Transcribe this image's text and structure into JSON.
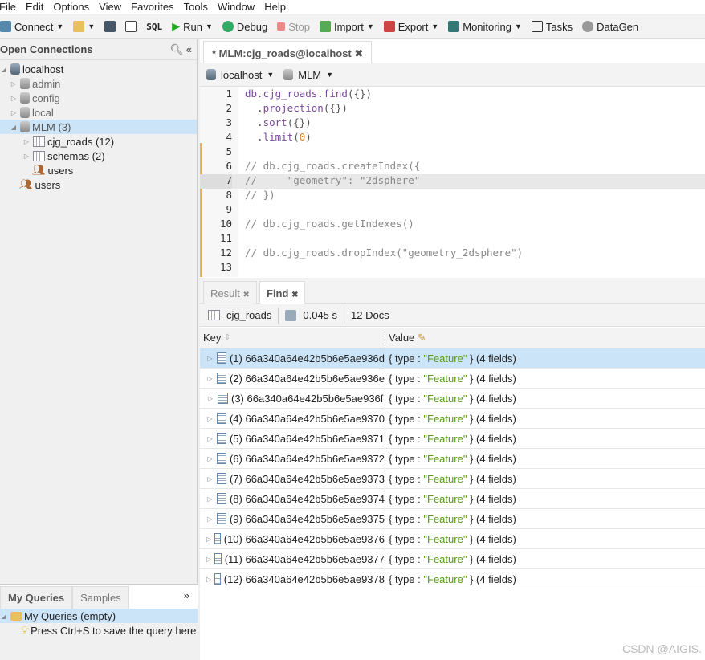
{
  "menu": [
    "File",
    "Edit",
    "Options",
    "View",
    "Favorites",
    "Tools",
    "Window",
    "Help"
  ],
  "toolbar": {
    "connect": "Connect",
    "sql": "SQL",
    "run": "Run",
    "debug": "Debug",
    "stop": "Stop",
    "import": "Import",
    "export": "Export",
    "monitoring": "Monitoring",
    "tasks": "Tasks",
    "datagen": "DataGen"
  },
  "left": {
    "title": "Open Connections",
    "tree": {
      "host": "localhost",
      "admin": "admin",
      "config": "config",
      "local": "local",
      "mlm": "MLM (3)",
      "cjg": "cjg_roads (12)",
      "schemas": "schemas (2)",
      "users_db": "users",
      "users": "users"
    }
  },
  "queries": {
    "tab1": "My Queries",
    "tab2": "Samples",
    "item": "My Queries (empty)",
    "hint": "Press Ctrl+S to save the query here"
  },
  "editor": {
    "tab": "* MLM:cjg_roads@localhost",
    "conn": "localhost",
    "db": "MLM",
    "lines": [
      {
        "n": "1",
        "parts": [
          [
            "fn",
            "db.cjg_roads.find"
          ],
          [
            "kw",
            "({})"
          ]
        ]
      },
      {
        "n": "2",
        "parts": [
          [
            "kw",
            "  ."
          ],
          [
            "fn",
            "projection"
          ],
          [
            "kw",
            "({})"
          ]
        ]
      },
      {
        "n": "3",
        "parts": [
          [
            "kw",
            "  ."
          ],
          [
            "fn",
            "sort"
          ],
          [
            "kw",
            "({})"
          ]
        ]
      },
      {
        "n": "4",
        "parts": [
          [
            "kw",
            "  ."
          ],
          [
            "fn",
            "limit"
          ],
          [
            "kw",
            "("
          ],
          [
            "num",
            "0"
          ],
          [
            "kw",
            ")"
          ]
        ]
      },
      {
        "n": "5",
        "parts": []
      },
      {
        "n": "6",
        "parts": [
          [
            "cm",
            "// db.cjg_roads.createIndex({"
          ]
        ]
      },
      {
        "n": "7",
        "parts": [
          [
            "cm",
            "//     \"geometry\": \"2dsphere\""
          ]
        ]
      },
      {
        "n": "8",
        "parts": [
          [
            "cm",
            "// })"
          ]
        ]
      },
      {
        "n": "9",
        "parts": []
      },
      {
        "n": "10",
        "parts": [
          [
            "cm",
            "// db.cjg_roads.getIndexes()"
          ]
        ]
      },
      {
        "n": "11",
        "parts": []
      },
      {
        "n": "12",
        "parts": [
          [
            "cm",
            "// db.cjg_roads.dropIndex(\"geometry_2dsphere\")"
          ]
        ]
      },
      {
        "n": "13",
        "parts": []
      }
    ]
  },
  "results": {
    "tab1": "Result",
    "tab2": "Find",
    "collection": "cjg_roads",
    "time": "0.045 s",
    "count": "12 Docs",
    "key_header": "Key",
    "value_header": "Value",
    "rows": [
      {
        "key": "(1) 66a340a64e42b5b6e5ae936d",
        "type": "Feature",
        "fields": "(4 fields)"
      },
      {
        "key": "(2) 66a340a64e42b5b6e5ae936e",
        "type": "Feature",
        "fields": "(4 fields)"
      },
      {
        "key": "(3) 66a340a64e42b5b6e5ae936f",
        "type": "Feature",
        "fields": "(4 fields)"
      },
      {
        "key": "(4) 66a340a64e42b5b6e5ae9370",
        "type": "Feature",
        "fields": "(4 fields)"
      },
      {
        "key": "(5) 66a340a64e42b5b6e5ae9371",
        "type": "Feature",
        "fields": "(4 fields)"
      },
      {
        "key": "(6) 66a340a64e42b5b6e5ae9372",
        "type": "Feature",
        "fields": "(4 fields)"
      },
      {
        "key": "(7) 66a340a64e42b5b6e5ae9373",
        "type": "Feature",
        "fields": "(4 fields)"
      },
      {
        "key": "(8) 66a340a64e42b5b6e5ae9374",
        "type": "Feature",
        "fields": "(4 fields)"
      },
      {
        "key": "(9) 66a340a64e42b5b6e5ae9375",
        "type": "Feature",
        "fields": "(4 fields)"
      },
      {
        "key": "(10) 66a340a64e42b5b6e5ae9376",
        "type": "Feature",
        "fields": "(4 fields)"
      },
      {
        "key": "(11) 66a340a64e42b5b6e5ae9377",
        "type": "Feature",
        "fields": "(4 fields)"
      },
      {
        "key": "(12) 66a340a64e42b5b6e5ae9378",
        "type": "Feature",
        "fields": "(4 fields)"
      }
    ]
  },
  "watermark": "CSDN @AIGIS."
}
